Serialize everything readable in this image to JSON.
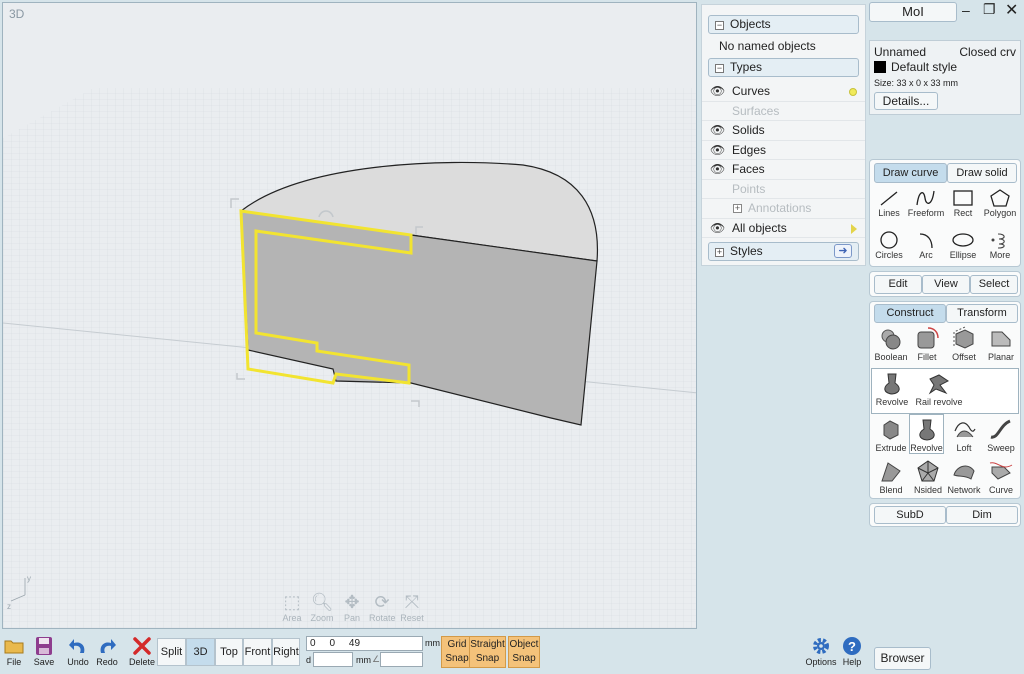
{
  "viewport": {
    "label": "3D"
  },
  "nav_tools": [
    "Area",
    "Zoom",
    "Pan",
    "Rotate",
    "Reset"
  ],
  "window": {
    "app_name": "MoI"
  },
  "objects_panel": {
    "objects_header": "Objects",
    "no_named": "No named objects",
    "types_header": "Types",
    "types": [
      {
        "label": "Curves",
        "visible": true,
        "enabled": true
      },
      {
        "label": "Surfaces",
        "visible": false,
        "enabled": false
      },
      {
        "label": "Solids",
        "visible": true,
        "enabled": true
      },
      {
        "label": "Edges",
        "visible": true,
        "enabled": true
      },
      {
        "label": "Faces",
        "visible": true,
        "enabled": true
      },
      {
        "label": "Points",
        "visible": false,
        "enabled": false
      },
      {
        "label": "Annotations",
        "visible": false,
        "enabled": false
      },
      {
        "label": "All objects",
        "visible": true,
        "enabled": true
      }
    ],
    "styles_header": "Styles"
  },
  "properties": {
    "name": "Unnamed",
    "type": "Closed crv",
    "style": "Default style",
    "size": "Size: 33 x 0 x 33 mm",
    "details_button": "Details..."
  },
  "draw_tabs": {
    "curve": "Draw curve",
    "solid": "Draw solid"
  },
  "draw_tools": [
    "Lines",
    "Freeform",
    "Rect",
    "Polygon",
    "Circles",
    "Arc",
    "Ellipse",
    "More"
  ],
  "edit_tabs": [
    "Edit",
    "View",
    "Select"
  ],
  "construct_tabs": {
    "construct": "Construct",
    "transform": "Transform"
  },
  "construct_tools_row1": [
    "Boolean",
    "Fillet",
    "Offset",
    "Planar"
  ],
  "revolve_flyout": [
    "Revolve",
    "Rail revolve"
  ],
  "construct_tools_row2": [
    "Extrude",
    "Revolve",
    "Loft",
    "Sweep"
  ],
  "construct_tools_row3": [
    "Blend",
    "Nsided",
    "Network",
    "Curve"
  ],
  "bottom_tabs": {
    "subd": "SubD",
    "dim": "Dim"
  },
  "bottom_bar": {
    "file": "File",
    "save": "Save",
    "undo": "Undo",
    "redo": "Redo",
    "delete": "Delete",
    "views": [
      "Split",
      "3D",
      "Top",
      "Front",
      "Right"
    ],
    "active_view": "3D",
    "coords": "0     0     49",
    "coord_unit": "mm",
    "d_label": "d",
    "d_unit": "mm",
    "angle_label": "∠",
    "snaps": [
      [
        "Grid",
        "Snap"
      ],
      [
        "Straight",
        "Snap"
      ],
      [
        "Object",
        "Snap"
      ]
    ],
    "options": "Options",
    "help": "Help",
    "browser": "Browser"
  },
  "colors": {
    "accent": "#c4dcec",
    "selection": "#ffee33",
    "snap": "#f4c27a"
  }
}
